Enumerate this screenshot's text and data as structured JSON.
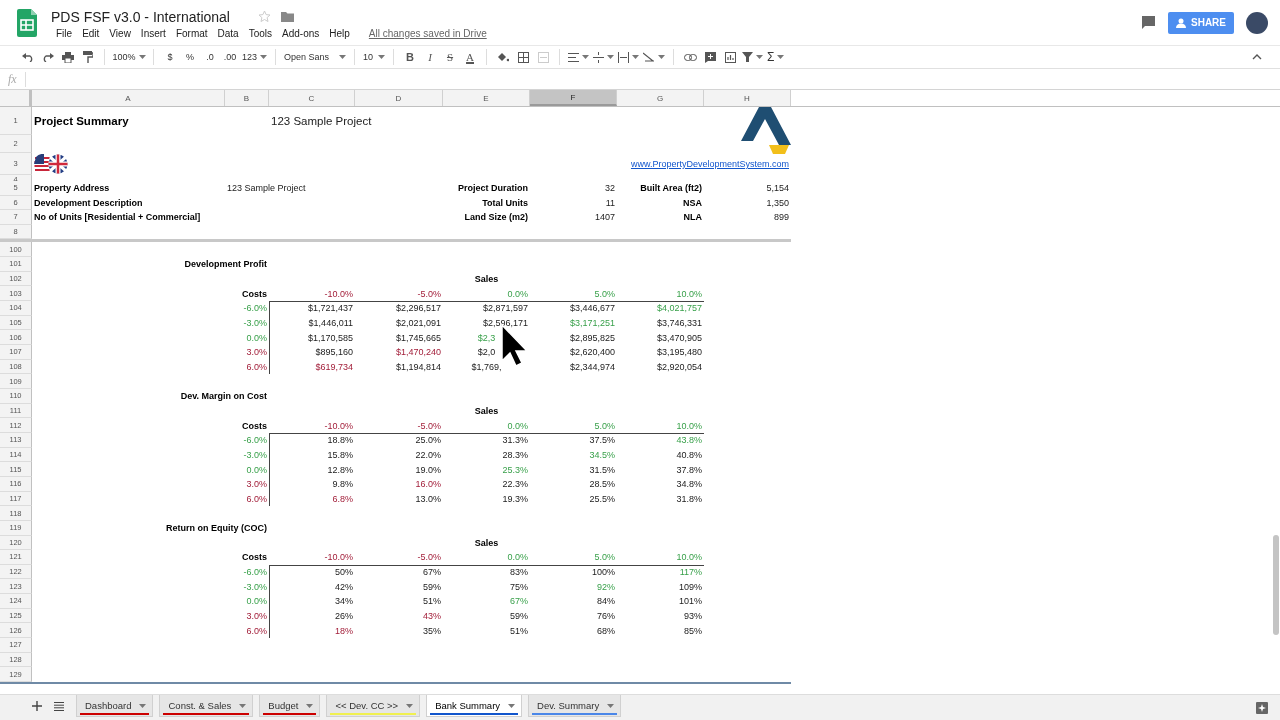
{
  "document": {
    "title": "PDS FSF v3.0 - International",
    "menu": [
      "File",
      "Edit",
      "View",
      "Insert",
      "Format",
      "Data",
      "Tools",
      "Add-ons",
      "Help"
    ],
    "save_status": "All changes saved in Drive",
    "share": "SHARE"
  },
  "toolbar": {
    "zoom": "100%",
    "number_formats": [
      "$",
      "%",
      ".0",
      ".00",
      "123"
    ],
    "font": "Open Sans",
    "font_size": "10",
    "text_styles": [
      "B",
      "I",
      "S",
      "A"
    ],
    "functions": "Σ"
  },
  "formula_bar": {
    "label": "fx"
  },
  "columns": [
    {
      "label": "A",
      "selected": false
    },
    {
      "label": "B",
      "selected": false
    },
    {
      "label": "C",
      "selected": false
    },
    {
      "label": "D",
      "selected": false
    },
    {
      "label": "E",
      "selected": false
    },
    {
      "label": "F",
      "selected": true
    },
    {
      "label": "G",
      "selected": false
    },
    {
      "label": "H",
      "selected": false
    }
  ],
  "frozen_rows": [
    {
      "number": "1",
      "cells": {
        "A": {
          "kind": "title",
          "text": "Project Summary"
        },
        "C": {
          "kind": "subtitle",
          "text": "123 Sample Project"
        },
        "H": {
          "kind": "logo"
        }
      }
    },
    {
      "number": "2"
    },
    {
      "number": "3",
      "cells": {
        "A": {
          "kind": "flags"
        },
        "H": {
          "kind": "link",
          "text": "www.PropertyDevelopmentSystem.com"
        }
      }
    },
    {
      "number": "4"
    },
    {
      "number": "5",
      "cells": {
        "A": {
          "kind": "field",
          "text": "Property Address"
        },
        "B": {
          "kind": "field_value",
          "text": "123 Sample Project"
        },
        "E": {
          "kind": "label",
          "text": "Project Duration"
        },
        "F": {
          "kind": "value",
          "text": "32"
        },
        "G": {
          "kind": "label",
          "text": "Built Area (ft2)"
        },
        "H": {
          "kind": "value",
          "text": "5,154"
        }
      }
    },
    {
      "number": "6",
      "cells": {
        "A": {
          "kind": "field",
          "text": "Development Description"
        },
        "E": {
          "kind": "label",
          "text": "Total Units"
        },
        "F": {
          "kind": "value",
          "text": "11"
        },
        "G": {
          "kind": "label",
          "text": "NSA"
        },
        "H": {
          "kind": "value",
          "text": "1,350"
        }
      }
    },
    {
      "number": "7",
      "cells": {
        "A": {
          "kind": "field",
          "text": "No of Units [Residential + Commercial]"
        },
        "E": {
          "kind": "label",
          "text": "Land Size (m2)"
        },
        "F": {
          "kind": "value",
          "text": "1407"
        },
        "G": {
          "kind": "label",
          "text": "NLA"
        },
        "H": {
          "kind": "value",
          "text": "899"
        }
      }
    },
    {
      "number": "8"
    }
  ],
  "rows": [
    {
      "number": "100"
    },
    {
      "number": "101",
      "cells": {
        "B": {
          "kind": "label",
          "text": "Development Profit"
        }
      }
    },
    {
      "number": "102",
      "cells": {
        "E": {
          "kind": "header",
          "text": "Sales"
        }
      }
    },
    {
      "number": "103",
      "cells": {
        "B": {
          "kind": "label",
          "text": "Costs"
        },
        "C": {
          "kind": "loss",
          "text": "-10.0%"
        },
        "D": {
          "kind": "loss",
          "text": "-5.0%"
        },
        "E": {
          "kind": "gain",
          "text": "0.0%"
        },
        "F": {
          "kind": "gain",
          "text": "5.0%"
        },
        "G": {
          "kind": "gain",
          "text": "10.0%"
        }
      }
    },
    {
      "number": "104",
      "kind": "data",
      "rule_above": true,
      "cells": {
        "B": {
          "kind": "gain",
          "text": "-6.0%"
        },
        "C": {
          "kind": "value",
          "text": "$1,721,437"
        },
        "D": {
          "kind": "value",
          "text": "$2,296,517"
        },
        "E": {
          "kind": "value",
          "text": "$2,871,597"
        },
        "F": {
          "kind": "value",
          "text": "$3,446,677"
        },
        "G": {
          "kind": "gain",
          "text": "$4,021,757"
        }
      }
    },
    {
      "number": "105",
      "kind": "data",
      "rule_above": false,
      "cells": {
        "B": {
          "kind": "gain",
          "text": "-3.0%"
        },
        "C": {
          "kind": "value",
          "text": "$1,446,011"
        },
        "D": {
          "kind": "value",
          "text": "$2,021,091"
        },
        "E": {
          "kind": "value",
          "text": "$2,596,171"
        },
        "F": {
          "kind": "gain",
          "text": "$3,171,251"
        },
        "G": {
          "kind": "value",
          "text": "$3,746,331"
        }
      }
    },
    {
      "number": "106",
      "kind": "data",
      "rule_above": false,
      "cells": {
        "B": {
          "kind": "gain",
          "text": "0.0%"
        },
        "C": {
          "kind": "value",
          "text": "$1,170,585"
        },
        "D": {
          "kind": "value",
          "text": "$1,745,665"
        },
        "E": {
          "kind": "gain_partial",
          "text": "$2,3"
        },
        "F": {
          "kind": "value",
          "text": "$2,895,825"
        },
        "G": {
          "kind": "value",
          "text": "$3,470,905"
        }
      }
    },
    {
      "number": "107",
      "kind": "data",
      "rule_above": false,
      "cells": {
        "B": {
          "kind": "loss",
          "text": "3.0%"
        },
        "C": {
          "kind": "value",
          "text": "$895,160"
        },
        "D": {
          "kind": "loss",
          "text": "$1,470,240"
        },
        "E": {
          "kind": "partial",
          "text": "$2,0"
        },
        "F": {
          "kind": "value",
          "text": "$2,620,400"
        },
        "G": {
          "kind": "value",
          "text": "$3,195,480"
        }
      }
    },
    {
      "number": "108",
      "kind": "data",
      "rule_above": false,
      "cells": {
        "B": {
          "kind": "loss",
          "text": "6.0%"
        },
        "C": {
          "kind": "loss",
          "text": "$619,734"
        },
        "D": {
          "kind": "value",
          "text": "$1,194,814"
        },
        "E": {
          "kind": "partial",
          "text": "$1,769,"
        },
        "F": {
          "kind": "value",
          "text": "$2,344,974"
        },
        "G": {
          "kind": "value",
          "text": "$2,920,054"
        }
      }
    },
    {
      "number": "109"
    },
    {
      "number": "110",
      "cells": {
        "B": {
          "kind": "label",
          "text": "Dev. Margin on Cost"
        }
      }
    },
    {
      "number": "111",
      "cells": {
        "E": {
          "kind": "header",
          "text": "Sales"
        }
      }
    },
    {
      "number": "112",
      "cells": {
        "B": {
          "kind": "label",
          "text": "Costs"
        },
        "C": {
          "kind": "loss",
          "text": "-10.0%"
        },
        "D": {
          "kind": "loss",
          "text": "-5.0%"
        },
        "E": {
          "kind": "gain",
          "text": "0.0%"
        },
        "F": {
          "kind": "gain",
          "text": "5.0%"
        },
        "G": {
          "kind": "gain",
          "text": "10.0%"
        }
      }
    },
    {
      "number": "113",
      "kind": "data",
      "rule_above": true,
      "cells": {
        "B": {
          "kind": "gain",
          "text": "-6.0%"
        },
        "C": {
          "kind": "value",
          "text": "18.8%"
        },
        "D": {
          "kind": "value",
          "text": "25.0%"
        },
        "E": {
          "kind": "value",
          "text": "31.3%"
        },
        "F": {
          "kind": "value",
          "text": "37.5%"
        },
        "G": {
          "kind": "gain",
          "text": "43.8%"
        }
      }
    },
    {
      "number": "114",
      "kind": "data",
      "rule_above": false,
      "cells": {
        "B": {
          "kind": "gain",
          "text": "-3.0%"
        },
        "C": {
          "kind": "value",
          "text": "15.8%"
        },
        "D": {
          "kind": "value",
          "text": "22.0%"
        },
        "E": {
          "kind": "value",
          "text": "28.3%"
        },
        "F": {
          "kind": "gain",
          "text": "34.5%"
        },
        "G": {
          "kind": "value",
          "text": "40.8%"
        }
      }
    },
    {
      "number": "115",
      "kind": "data",
      "rule_above": false,
      "cells": {
        "B": {
          "kind": "gain",
          "text": "0.0%"
        },
        "C": {
          "kind": "value",
          "text": "12.8%"
        },
        "D": {
          "kind": "value",
          "text": "19.0%"
        },
        "E": {
          "kind": "gain",
          "text": "25.3%"
        },
        "F": {
          "kind": "value",
          "text": "31.5%"
        },
        "G": {
          "kind": "value",
          "text": "37.8%"
        }
      }
    },
    {
      "number": "116",
      "kind": "data",
      "rule_above": false,
      "cells": {
        "B": {
          "kind": "loss",
          "text": "3.0%"
        },
        "C": {
          "kind": "value",
          "text": "9.8%"
        },
        "D": {
          "kind": "loss",
          "text": "16.0%"
        },
        "E": {
          "kind": "value",
          "text": "22.3%"
        },
        "F": {
          "kind": "value",
          "text": "28.5%"
        },
        "G": {
          "kind": "value",
          "text": "34.8%"
        }
      }
    },
    {
      "number": "117",
      "kind": "data",
      "rule_above": false,
      "cells": {
        "B": {
          "kind": "loss",
          "text": "6.0%"
        },
        "C": {
          "kind": "loss",
          "text": "6.8%"
        },
        "D": {
          "kind": "value",
          "text": "13.0%"
        },
        "E": {
          "kind": "value",
          "text": "19.3%"
        },
        "F": {
          "kind": "value",
          "text": "25.5%"
        },
        "G": {
          "kind": "value",
          "text": "31.8%"
        }
      }
    },
    {
      "number": "118"
    },
    {
      "number": "119",
      "cells": {
        "B": {
          "kind": "label",
          "text": "Return on Equity (COC)"
        }
      }
    },
    {
      "number": "120",
      "cells": {
        "E": {
          "kind": "header",
          "text": "Sales"
        }
      }
    },
    {
      "number": "121",
      "cells": {
        "B": {
          "kind": "label",
          "text": "Costs"
        },
        "C": {
          "kind": "loss",
          "text": "-10.0%"
        },
        "D": {
          "kind": "loss",
          "text": "-5.0%"
        },
        "E": {
          "kind": "gain",
          "text": "0.0%"
        },
        "F": {
          "kind": "gain",
          "text": "5.0%"
        },
        "G": {
          "kind": "gain",
          "text": "10.0%"
        }
      }
    },
    {
      "number": "122",
      "kind": "data",
      "rule_above": true,
      "cells": {
        "B": {
          "kind": "gain",
          "text": "-6.0%"
        },
        "C": {
          "kind": "value",
          "text": "50%"
        },
        "D": {
          "kind": "value",
          "text": "67%"
        },
        "E": {
          "kind": "value",
          "text": "83%"
        },
        "F": {
          "kind": "value",
          "text": "100%"
        },
        "G": {
          "kind": "gain",
          "text": "117%"
        }
      }
    },
    {
      "number": "123",
      "kind": "data",
      "rule_above": false,
      "cells": {
        "B": {
          "kind": "gain",
          "text": "-3.0%"
        },
        "C": {
          "kind": "value",
          "text": "42%"
        },
        "D": {
          "kind": "value",
          "text": "59%"
        },
        "E": {
          "kind": "value",
          "text": "75%"
        },
        "F": {
          "kind": "gain",
          "text": "92%"
        },
        "G": {
          "kind": "value",
          "text": "109%"
        }
      }
    },
    {
      "number": "124",
      "kind": "data",
      "rule_above": false,
      "cells": {
        "B": {
          "kind": "gain",
          "text": "0.0%"
        },
        "C": {
          "kind": "value",
          "text": "34%"
        },
        "D": {
          "kind": "value",
          "text": "51%"
        },
        "E": {
          "kind": "gain",
          "text": "67%"
        },
        "F": {
          "kind": "value",
          "text": "84%"
        },
        "G": {
          "kind": "value",
          "text": "101%"
        }
      }
    },
    {
      "number": "125",
      "kind": "data",
      "rule_above": false,
      "cells": {
        "B": {
          "kind": "loss",
          "text": "3.0%"
        },
        "C": {
          "kind": "value",
          "text": "26%"
        },
        "D": {
          "kind": "loss",
          "text": "43%"
        },
        "E": {
          "kind": "value",
          "text": "59%"
        },
        "F": {
          "kind": "value",
          "text": "76%"
        },
        "G": {
          "kind": "value",
          "text": "93%"
        }
      }
    },
    {
      "number": "126",
      "kind": "data",
      "rule_above": false,
      "cells": {
        "B": {
          "kind": "loss",
          "text": "6.0%"
        },
        "C": {
          "kind": "loss",
          "text": "18%"
        },
        "D": {
          "kind": "value",
          "text": "35%"
        },
        "E": {
          "kind": "value",
          "text": "51%"
        },
        "F": {
          "kind": "value",
          "text": "68%"
        },
        "G": {
          "kind": "value",
          "text": "85%"
        }
      }
    },
    {
      "number": "127"
    },
    {
      "number": "128"
    },
    {
      "number": "129"
    }
  ],
  "tabs": [
    {
      "label": "Dashboard",
      "color": "#cc0000",
      "selected": false
    },
    {
      "label": "Const. & Sales",
      "color": "#cc0000",
      "selected": false
    },
    {
      "label": "Budget",
      "color": "#cc0000",
      "selected": false
    },
    {
      "label": "<< Dev. CC >>",
      "color": "#f0f050",
      "selected": false
    },
    {
      "label": "Bank Summary",
      "color": "#1155cc",
      "selected": true
    },
    {
      "label": "Dev. Summary",
      "color": "#4a86e8",
      "selected": false
    }
  ]
}
